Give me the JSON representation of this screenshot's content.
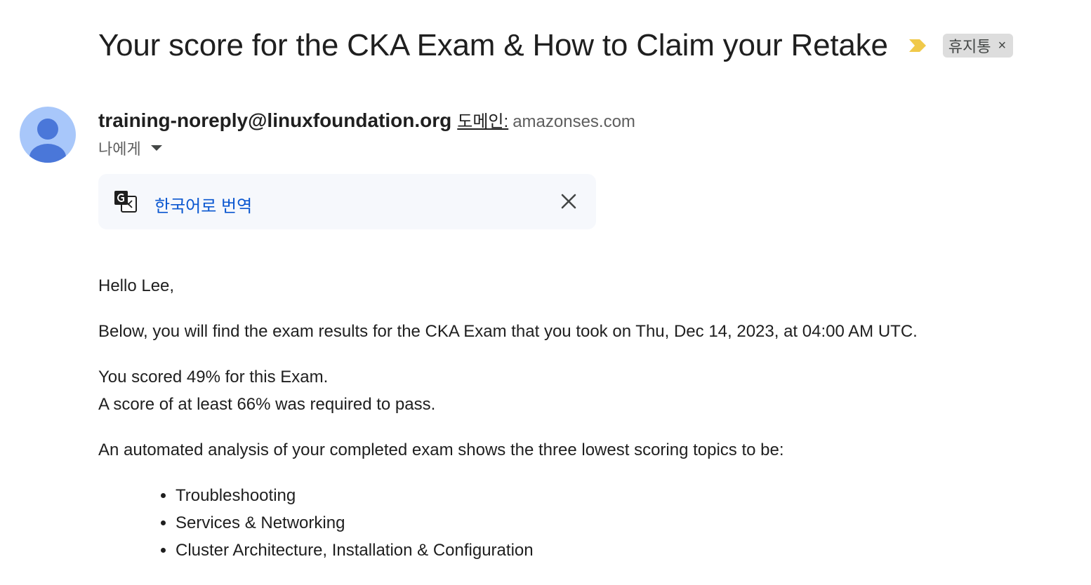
{
  "email": {
    "subject": "Your score for the CKA Exam & How to Claim your Retake",
    "label_chip": {
      "text": "휴지통",
      "remove_glyph": "×"
    },
    "important_marker_color": "#f0c94a",
    "sender": {
      "email": "training-noreply@linuxfoundation.org",
      "via_label": "도메인:",
      "via_domain": "amazonses.com"
    },
    "recipient": "나에게",
    "translate_bar": {
      "link_text": "한국어로 번역",
      "icon": "google-translate-icon",
      "close_icon": "close-icon"
    },
    "body": {
      "greeting": "Hello Lee,",
      "paragraph1": "Below, you will find the exam results for the CKA Exam that you took on Thu, Dec 14, 2023, at 04:00 AM UTC.",
      "score_line": "You scored 49% for this Exam.",
      "required_line": "A score of at least 66% was required to pass.",
      "analysis_intro": "An automated analysis of your completed exam shows the three lowest scoring topics to be:",
      "topics": [
        "Troubleshooting",
        "Services & Networking",
        "Cluster Architecture, Installation & Configuration"
      ]
    }
  },
  "colors": {
    "link_blue": "#0b57d0",
    "avatar_bg": "#a8c7fa",
    "avatar_fg": "#4a77d9",
    "translate_bg": "#f6f8fc"
  }
}
